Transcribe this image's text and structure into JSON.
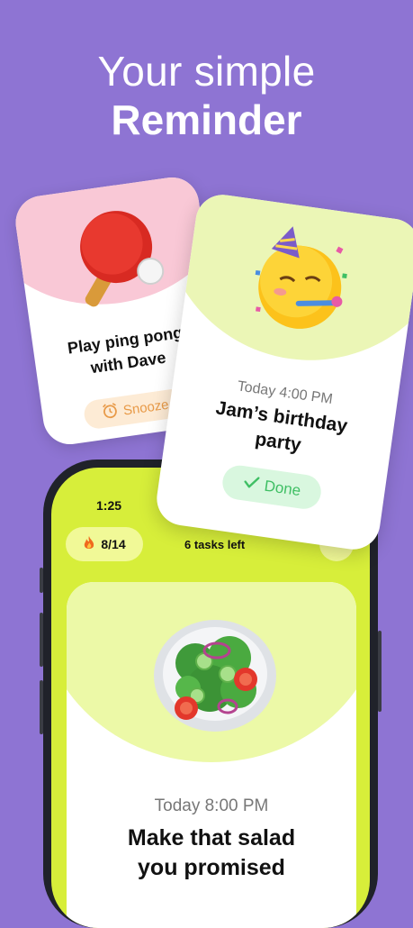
{
  "headline": {
    "line1": "Your simple",
    "line2": "Reminder"
  },
  "phone": {
    "status_time": "1:25",
    "streak": "8/14",
    "tasks_left": "6 tasks left",
    "task": {
      "time": "Today 8:00 PM",
      "title_line1": "Make that salad",
      "title_line2": "you promised",
      "icon": "salad-icon"
    }
  },
  "card_pingpong": {
    "title_line1": "Play ping pong",
    "title_line2": "with Dave",
    "action": "Snooze",
    "icon": "ping-pong-icon"
  },
  "card_birthday": {
    "time": "Today 4:00 PM",
    "title_line1": "Jam’s birthday",
    "title_line2": "party",
    "action": "Done",
    "icon": "party-face-icon"
  },
  "colors": {
    "background": "#8e74d3",
    "accent_lime": "#d7ee3a",
    "pink": "#f9c8d6",
    "done_green": "#3fbf64",
    "snooze_orange": "#e89a48"
  }
}
